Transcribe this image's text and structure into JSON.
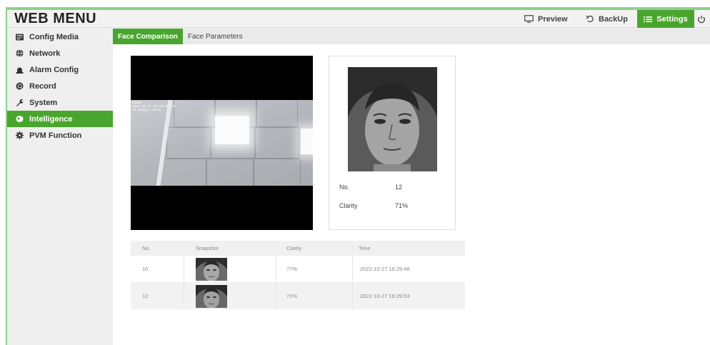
{
  "header": {
    "title": "WEB MENU",
    "preview_label": "Preview",
    "backup_label": "BackUp",
    "settings_label": "Settings"
  },
  "sidebar": {
    "items": [
      {
        "label": "Config Media",
        "icon": "config-media-icon"
      },
      {
        "label": "Network",
        "icon": "network-icon"
      },
      {
        "label": "Alarm Config",
        "icon": "alarm-icon"
      },
      {
        "label": "Record",
        "icon": "record-icon"
      },
      {
        "label": "System",
        "icon": "wrench-icon"
      },
      {
        "label": "Intelligence",
        "icon": "intelligence-icon",
        "active": true
      },
      {
        "label": "PVM Function",
        "icon": "gear-icon"
      }
    ]
  },
  "tabs": [
    {
      "label": "Face Comparison",
      "active": true
    },
    {
      "label": "Face Parameters",
      "active": false
    }
  ],
  "video": {
    "osd_line1": "Cam00",
    "osd_line2": "2022-10-27 16:29:51 Thr",
    "osd_line3": "70.93kbps 30fps"
  },
  "capture": {
    "no_label": "No.",
    "no_value": "12",
    "clarity_label": "Clarity",
    "clarity_value": "71%"
  },
  "table": {
    "headers": [
      "No.",
      "Snapshot",
      "Clarity",
      "Time"
    ],
    "rows": [
      {
        "no": "10",
        "clarity": "77%",
        "time": "2022-10-27 16:29:48"
      },
      {
        "no": "12",
        "clarity": "71%",
        "time": "2022-10-27 16:29:53"
      }
    ]
  },
  "colors": {
    "accent": "#4aa52e",
    "frame_border": "#8fd08b"
  }
}
